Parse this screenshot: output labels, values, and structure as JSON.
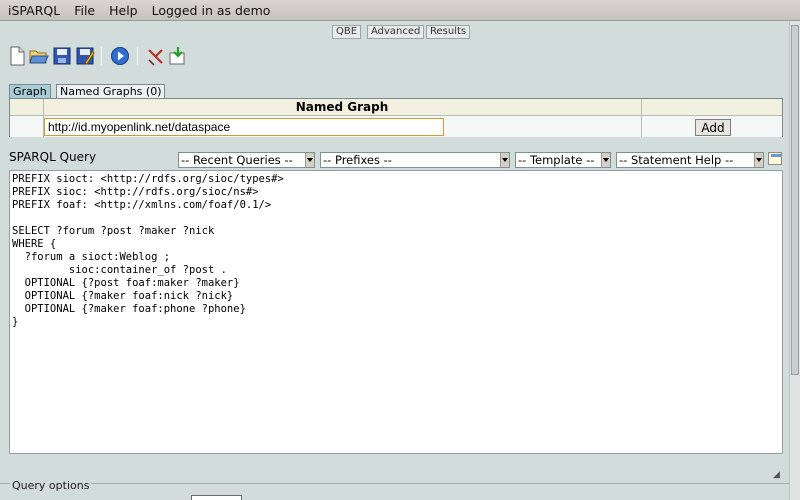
{
  "menu": {
    "app_name": "iSPARQL",
    "file": "File",
    "help": "Help",
    "logged_in": "Logged in as demo"
  },
  "view_tabs": [
    "QBE",
    "Advanced",
    "Results"
  ],
  "toolbar": {
    "icons": [
      "new-icon",
      "open-icon",
      "save-icon",
      "save-as-icon",
      "run-icon",
      "clear-icon",
      "load-icon"
    ]
  },
  "graph_tabs": {
    "graph": "Graph",
    "named": "Named Graphs (0)"
  },
  "named_graph": {
    "header": "Named Graph",
    "value": "http://id.myopenlink.net/dataspace",
    "add_label": "Add"
  },
  "query": {
    "label": "SPARQL Query",
    "recent": "-- Recent Queries --",
    "prefixes": "-- Prefixes --",
    "template": "-- Template --",
    "statement_help": "-- Statement Help --",
    "text": "PREFIX sioct: <http://rdfs.org/sioc/types#>\nPREFIX sioc: <http://rdfs.org/sioc/ns#>\nPREFIX foaf: <http://xmlns.com/foaf/0.1/>\n\nSELECT ?forum ?post ?maker ?nick\nWHERE {\n  ?forum a sioct:Weblog ;\n         sioc:container_of ?post .\n  OPTIONAL {?post foaf:maker ?maker}\n  OPTIONAL {?maker foaf:nick ?nick}\n  OPTIONAL {?maker foaf:phone ?phone}\n}"
  },
  "options": {
    "legend": "Query options"
  }
}
